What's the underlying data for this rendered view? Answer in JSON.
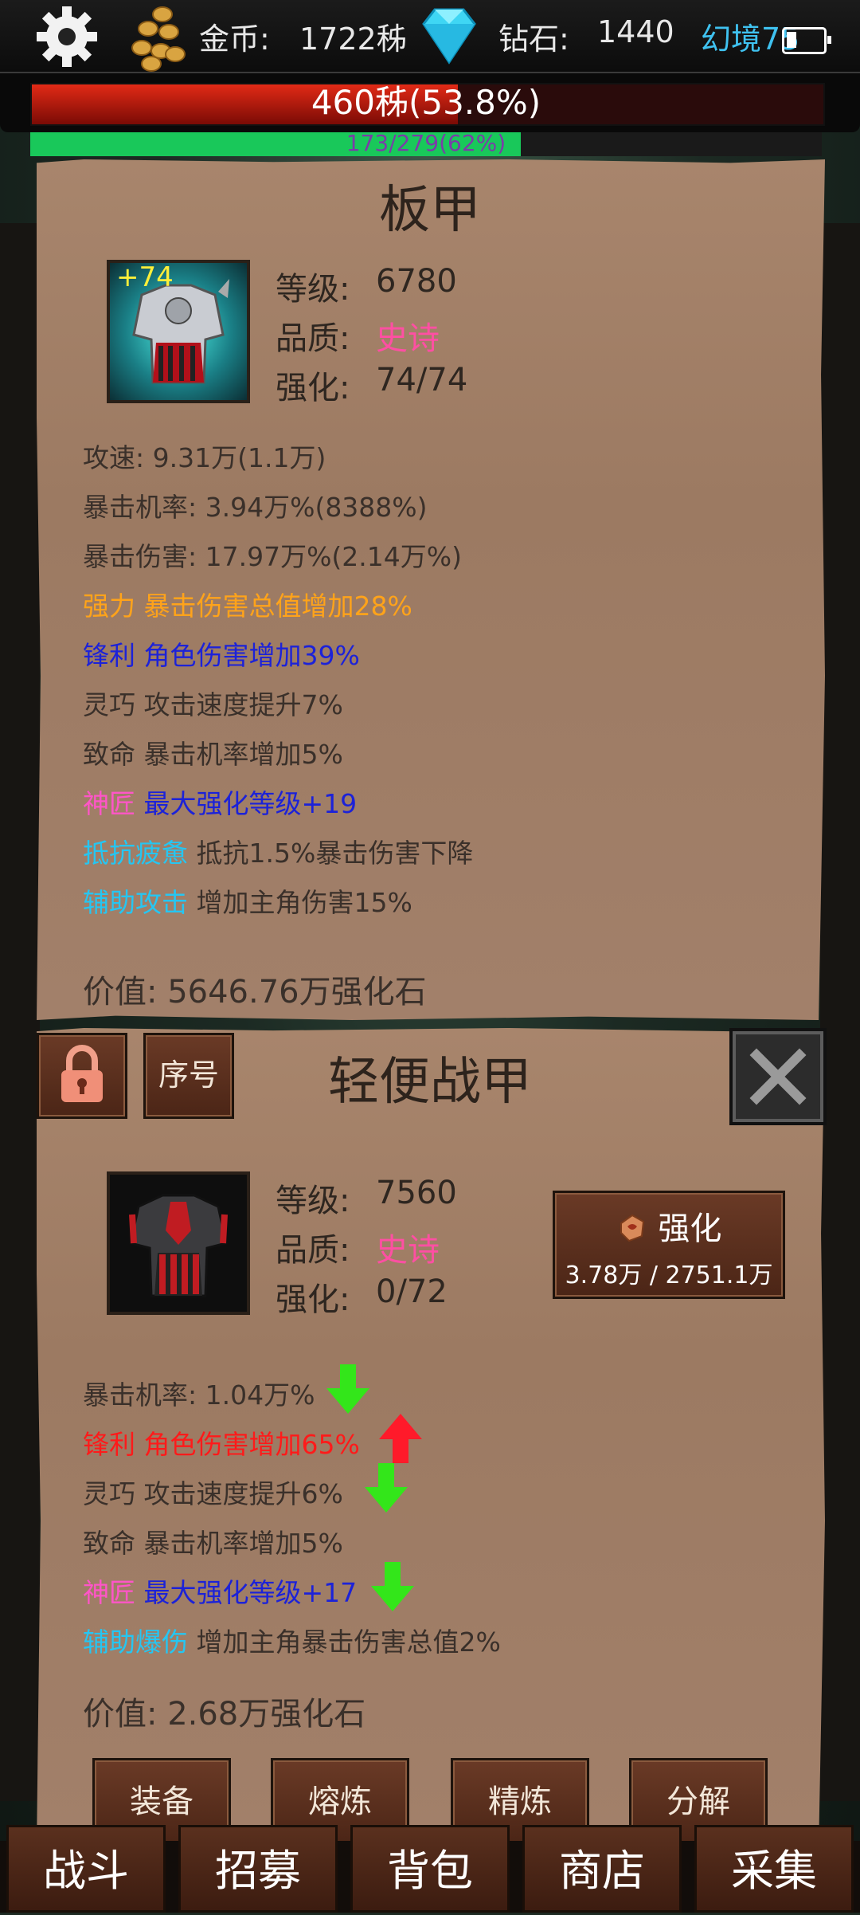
{
  "topbar": {
    "gold_label": "金币:",
    "gold_value": "1722秭",
    "diamond_label": "钻石:",
    "diamond_value": "1440",
    "realm": "幻境75"
  },
  "hp": {
    "text": "460秭(53.8%)",
    "percent": 53.8
  },
  "exp": {
    "text": "173/279(62%)",
    "percent": 62
  },
  "panel1": {
    "title": "板甲",
    "enhance_badge": "+74",
    "level_label": "等级:",
    "level_value": "6780",
    "quality_label": "品质:",
    "quality_value": "史诗",
    "enhance_label": "强化:",
    "enhance_value": "74/74",
    "attrs": [
      {
        "text": "攻速: 9.31万(1.1万)"
      },
      {
        "text": "暴击机率: 3.94万%(8388%)"
      },
      {
        "text": "暴击伤害: 17.97万%(2.14万%)"
      },
      {
        "text": "强力 暴击伤害总值增加28%"
      },
      {
        "text": "锋利 角色伤害增加39%"
      },
      {
        "text": "灵巧 攻击速度提升7%"
      },
      {
        "text": "致命 暴击机率增加5%"
      },
      {
        "prefix": "神匠",
        "text": "最大强化等级+19"
      },
      {
        "prefix": "抵抗疲惫",
        "text": "抵抗1.5%暴击伤害下降"
      },
      {
        "prefix": "辅助攻击",
        "text": "增加主角伤害15%"
      }
    ],
    "value_line": "价值: 5646.76万强化石"
  },
  "panel2": {
    "title": "轻便战甲",
    "serial_button": "序号",
    "level_label": "等级:",
    "level_value": "7560",
    "quality_label": "品质:",
    "quality_value": "史诗",
    "enhance_label": "强化:",
    "enhance_value": "0/72",
    "enhance_button": {
      "label": "强化",
      "cost": "3.78万 / 2751.1万"
    },
    "attrs": [
      {
        "text": "暴击机率: 1.04万%"
      },
      {
        "text": "锋利 角色伤害增加65%"
      },
      {
        "text": "灵巧 攻击速度提升6%"
      },
      {
        "text": "致命 暴击机率增加5%"
      },
      {
        "prefix": "神匠",
        "text": "最大强化等级+17"
      },
      {
        "prefix": "辅助爆伤",
        "text": "增加主角暴击伤害总值2%"
      }
    ],
    "value_line": "价值: 2.68万强化石",
    "actions": [
      "装备",
      "熔炼",
      "精炼",
      "分解"
    ]
  },
  "nav": [
    "战斗",
    "招募",
    "背包",
    "商店",
    "采集"
  ],
  "colors": {
    "parchment": "#a07e66",
    "epic": "#ff4fa3",
    "orange": "#ffa31a",
    "blue": "#1c22d8",
    "pink": "#ff55c8",
    "cyan": "#25c6f2",
    "red": "#ff1a1a",
    "green_arrow": "#33e61a",
    "red_arrow": "#ff1a2a"
  }
}
